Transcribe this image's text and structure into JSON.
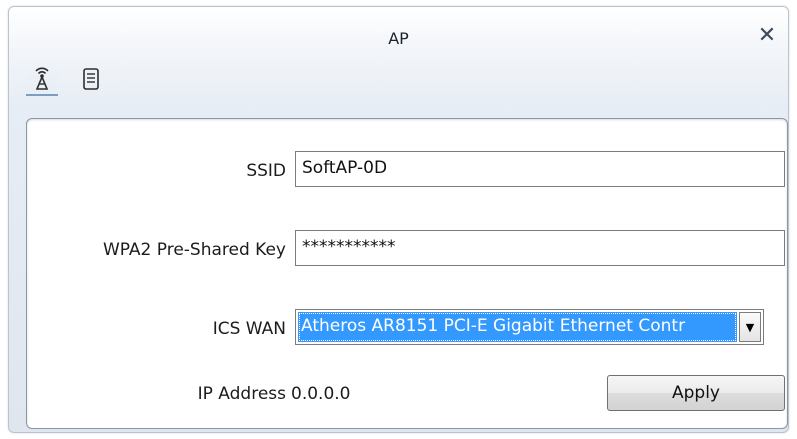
{
  "window": {
    "title": "AP",
    "close_symbol": "✕"
  },
  "tabs": [
    {
      "icon": "antenna-icon",
      "selected": true
    },
    {
      "icon": "document-icon",
      "selected": false
    }
  ],
  "form": {
    "ssid_label": "SSID",
    "ssid_value": "SoftAP-0D",
    "key_label": "WPA2 Pre-Shared Key",
    "key_value": "***********",
    "ics_label": "ICS WAN",
    "ics_selected": "Atheros AR8151 PCI-E Gigabit Ethernet Contr",
    "ip_label": "IP Address",
    "ip_value": "0.0.0.0",
    "apply_label": "Apply"
  },
  "colors": {
    "selection": "#3399ff",
    "tab_indicator": "#7e9dc2"
  }
}
